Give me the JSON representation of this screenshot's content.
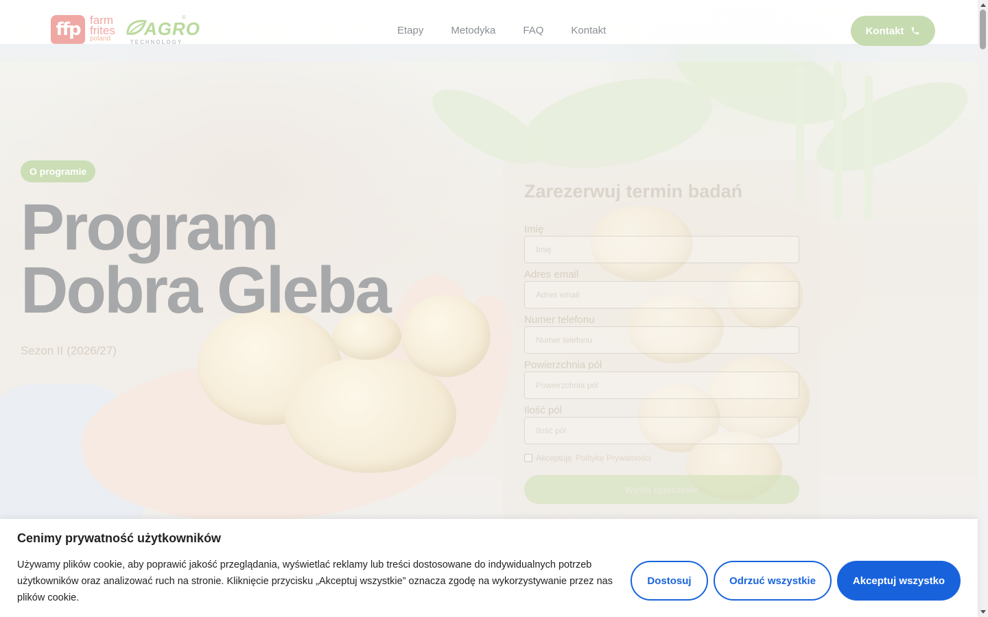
{
  "header": {
    "logo_ffp_mark": "ffp",
    "logo_ffp_line1": "farm",
    "logo_ffp_line2": "frites",
    "logo_ffp_line3": "poland",
    "logo_agro_word": "AGRO",
    "logo_agro_sub": "TECHNOLOGY",
    "logo_agro_reg": "®",
    "nav": [
      "Etapy",
      "Metodyka",
      "FAQ",
      "Kontakt"
    ],
    "cta_label": "Kontakt",
    "cta_icon": "phone-icon"
  },
  "hero": {
    "badge": "O programie",
    "title_line1": "Program",
    "title_line2": "Dobra Gleba",
    "subtitle": "Sezon II (2026/27)"
  },
  "form": {
    "title": "Zarezerwuj termin badań",
    "fields": [
      {
        "label": "Imię",
        "placeholder": "Imię"
      },
      {
        "label": "Adres email",
        "placeholder": "Adres email"
      },
      {
        "label": "Numer telefonu",
        "placeholder": "Numer telefonu"
      },
      {
        "label": "Powierzchnia pól",
        "placeholder": "Powierzchnia pól"
      },
      {
        "label": "Ilość pól",
        "placeholder": "Ilość pól"
      }
    ],
    "consent_prefix": "Akceptuję",
    "consent_link": "Politykę Prywatności",
    "submit_label": "Wyślij zgłoszenie"
  },
  "cookie_banner": {
    "title": "Cenimy prywatność użytkowników",
    "text": "Używamy plików cookie, aby poprawić jakość przeglądania, wyświetlać reklamy lub treści dostosowane do indywidualnych potrzeb użytkowników oraz analizować ruch na stronie. Kliknięcie przycisku „Akceptuj wszystkie” oznacza zgodę na wykorzystywanie przez nas plików cookie.",
    "btn_customize": "Dostosuj",
    "btn_reject": "Odrzuć wszystkie",
    "btn_accept": "Akceptuj wszystko"
  },
  "colors": {
    "accent_green": "#c6dbb0",
    "cookie_blue": "#1863dc",
    "logo_pink": "#efa8a4"
  }
}
